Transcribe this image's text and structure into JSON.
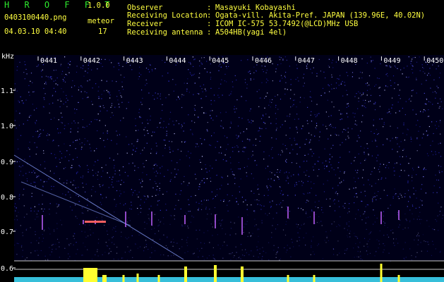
{
  "app": {
    "title": "H R O F F T",
    "version": "1.0.0",
    "filename": "0403100440.png",
    "datetime": "04.03.10 04:40",
    "count_label": "meteor",
    "count_value": "17"
  },
  "metadata": [
    {
      "key": "Observer",
      "value": "Masayuki Kobayashi"
    },
    {
      "key": "Receiving Location",
      "value": "Ogata-vill. Akita-Pref. JAPAN (139.96E, 40.02N)"
    },
    {
      "key": "Receiver",
      "value": "ICOM IC-575 53.7492(@LCD)MHz USB"
    },
    {
      "key": "Receiving antenna",
      "value": "A504HB(yagi 4el)"
    }
  ],
  "spectrogram": {
    "y_unit": "kHz",
    "y_ticks": [
      "1.1",
      "1.0",
      "0.9",
      "0.8",
      "0.7",
      "0.6"
    ],
    "time_ticks": [
      "0441",
      "0442",
      "0443",
      "0444",
      "0445",
      "0446",
      "0447",
      "0448",
      "0449",
      "0450"
    ],
    "colors": {
      "noise": "#1a1a9a",
      "tick_text": "#ffffff",
      "signal": "#ffff30",
      "baseline": "#40e0ff"
    }
  }
}
